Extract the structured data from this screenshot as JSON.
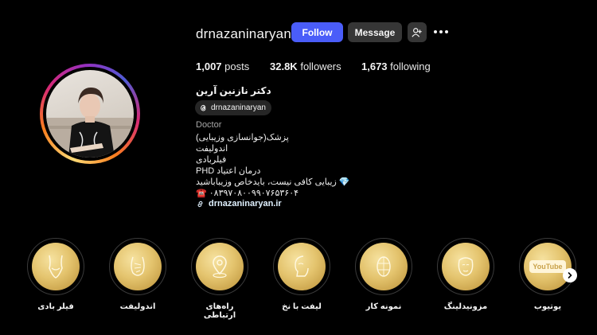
{
  "profile": {
    "username": "drnazaninaryan",
    "follow_label": "Follow",
    "message_label": "Message",
    "stats": {
      "posts_count": "1,007",
      "posts_label": "posts",
      "followers_count": "32.8K",
      "followers_label": "followers",
      "following_count": "1,673",
      "following_label": "following"
    },
    "full_name": "دکتر نازنین آرین",
    "threads_handle": "drnazaninaryan",
    "category": "Doctor",
    "bio_lines": [
      "پزشک(جوانسازی وزیبایی)",
      "اندولیفت",
      "فیلربادی",
      "PHD درمان اعتیاد",
      "💎 زیبایی کافی نیست، بایدخاص وزیباباشید",
      "☎️ ۰۸۳۹۷۰۸۰۰۹۹۰۷۶۵۳۶۰۴"
    ],
    "link_text": "drnazaninaryan.ir"
  },
  "highlights": [
    {
      "label": "فیلر بادی",
      "icon": "body-silhouette-icon"
    },
    {
      "label": "اندولیفت",
      "icon": "face-lines-icon"
    },
    {
      "label": "راه‌های ارتباطی",
      "icon": "location-pin-icon"
    },
    {
      "label": "لیفت با نخ",
      "icon": "face-profile-icon"
    },
    {
      "label": "نمونه کار",
      "icon": "face-grid-icon"
    },
    {
      "label": "مزونیدلینگ",
      "icon": "needle-face-icon"
    },
    {
      "label": "یوتیوب",
      "icon": "youtube-icon",
      "icon_text": "YouTube"
    }
  ],
  "colors": {
    "background": "#000000",
    "follow_button": "#4a5df9",
    "secondary_button": "#363636",
    "highlight_gold": "#e4c46e"
  }
}
